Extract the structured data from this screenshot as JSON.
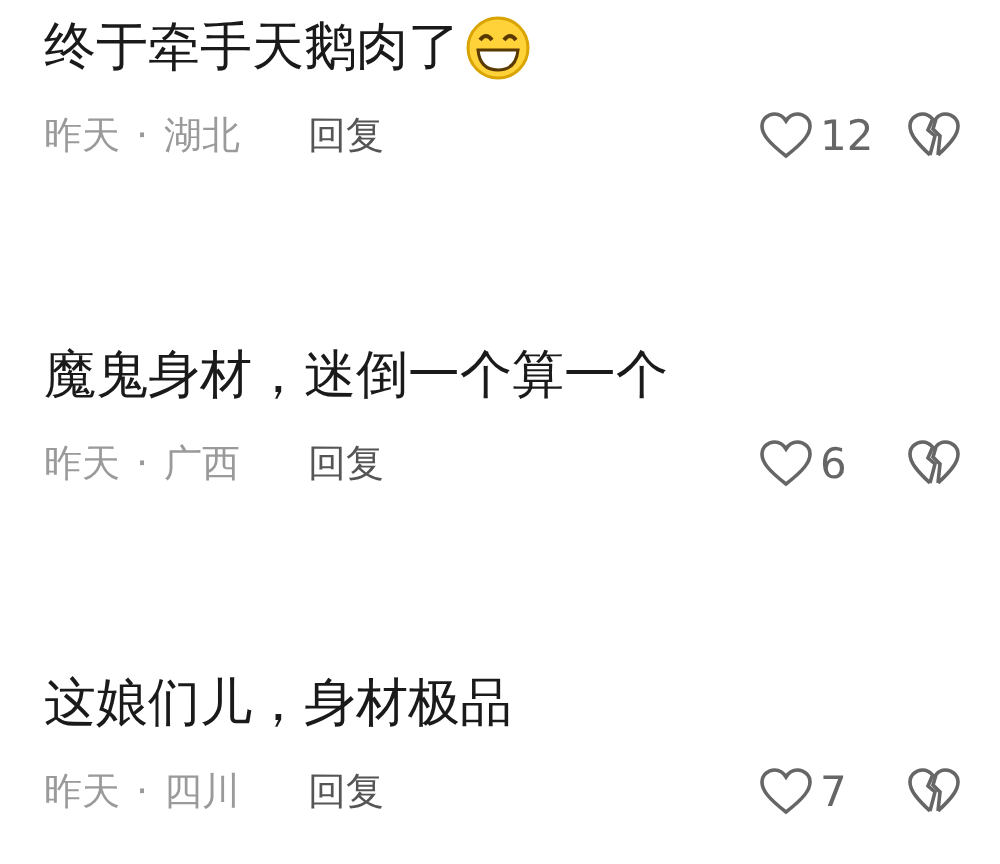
{
  "comments": [
    {
      "text": "终于牵手天鹅肉了",
      "emoji": true,
      "time": "昨天",
      "separator": "·",
      "location": "湖北",
      "reply": "回复",
      "likes": "12"
    },
    {
      "text": "魔鬼身材，迷倒一个算一个",
      "time": "昨天",
      "separator": "·",
      "location": "广西",
      "reply": "回复",
      "likes": "6"
    },
    {
      "text": "这娘们儿，身材极品",
      "time": "昨天",
      "separator": "·",
      "location": "四川",
      "reply": "回复",
      "likes": "7"
    }
  ]
}
